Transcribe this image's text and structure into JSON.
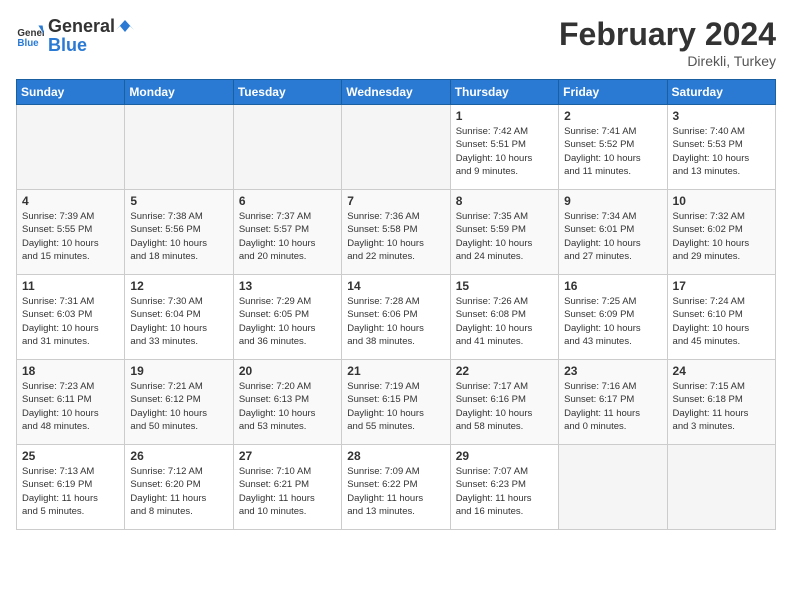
{
  "header": {
    "logo_general": "General",
    "logo_blue": "Blue",
    "title": "February 2024",
    "subtitle": "Direkli, Turkey"
  },
  "days_of_week": [
    "Sunday",
    "Monday",
    "Tuesday",
    "Wednesday",
    "Thursday",
    "Friday",
    "Saturday"
  ],
  "weeks": [
    [
      {
        "day": "",
        "info": ""
      },
      {
        "day": "",
        "info": ""
      },
      {
        "day": "",
        "info": ""
      },
      {
        "day": "",
        "info": ""
      },
      {
        "day": "1",
        "info": "Sunrise: 7:42 AM\nSunset: 5:51 PM\nDaylight: 10 hours\nand 9 minutes."
      },
      {
        "day": "2",
        "info": "Sunrise: 7:41 AM\nSunset: 5:52 PM\nDaylight: 10 hours\nand 11 minutes."
      },
      {
        "day": "3",
        "info": "Sunrise: 7:40 AM\nSunset: 5:53 PM\nDaylight: 10 hours\nand 13 minutes."
      }
    ],
    [
      {
        "day": "4",
        "info": "Sunrise: 7:39 AM\nSunset: 5:55 PM\nDaylight: 10 hours\nand 15 minutes."
      },
      {
        "day": "5",
        "info": "Sunrise: 7:38 AM\nSunset: 5:56 PM\nDaylight: 10 hours\nand 18 minutes."
      },
      {
        "day": "6",
        "info": "Sunrise: 7:37 AM\nSunset: 5:57 PM\nDaylight: 10 hours\nand 20 minutes."
      },
      {
        "day": "7",
        "info": "Sunrise: 7:36 AM\nSunset: 5:58 PM\nDaylight: 10 hours\nand 22 minutes."
      },
      {
        "day": "8",
        "info": "Sunrise: 7:35 AM\nSunset: 5:59 PM\nDaylight: 10 hours\nand 24 minutes."
      },
      {
        "day": "9",
        "info": "Sunrise: 7:34 AM\nSunset: 6:01 PM\nDaylight: 10 hours\nand 27 minutes."
      },
      {
        "day": "10",
        "info": "Sunrise: 7:32 AM\nSunset: 6:02 PM\nDaylight: 10 hours\nand 29 minutes."
      }
    ],
    [
      {
        "day": "11",
        "info": "Sunrise: 7:31 AM\nSunset: 6:03 PM\nDaylight: 10 hours\nand 31 minutes."
      },
      {
        "day": "12",
        "info": "Sunrise: 7:30 AM\nSunset: 6:04 PM\nDaylight: 10 hours\nand 33 minutes."
      },
      {
        "day": "13",
        "info": "Sunrise: 7:29 AM\nSunset: 6:05 PM\nDaylight: 10 hours\nand 36 minutes."
      },
      {
        "day": "14",
        "info": "Sunrise: 7:28 AM\nSunset: 6:06 PM\nDaylight: 10 hours\nand 38 minutes."
      },
      {
        "day": "15",
        "info": "Sunrise: 7:26 AM\nSunset: 6:08 PM\nDaylight: 10 hours\nand 41 minutes."
      },
      {
        "day": "16",
        "info": "Sunrise: 7:25 AM\nSunset: 6:09 PM\nDaylight: 10 hours\nand 43 minutes."
      },
      {
        "day": "17",
        "info": "Sunrise: 7:24 AM\nSunset: 6:10 PM\nDaylight: 10 hours\nand 45 minutes."
      }
    ],
    [
      {
        "day": "18",
        "info": "Sunrise: 7:23 AM\nSunset: 6:11 PM\nDaylight: 10 hours\nand 48 minutes."
      },
      {
        "day": "19",
        "info": "Sunrise: 7:21 AM\nSunset: 6:12 PM\nDaylight: 10 hours\nand 50 minutes."
      },
      {
        "day": "20",
        "info": "Sunrise: 7:20 AM\nSunset: 6:13 PM\nDaylight: 10 hours\nand 53 minutes."
      },
      {
        "day": "21",
        "info": "Sunrise: 7:19 AM\nSunset: 6:15 PM\nDaylight: 10 hours\nand 55 minutes."
      },
      {
        "day": "22",
        "info": "Sunrise: 7:17 AM\nSunset: 6:16 PM\nDaylight: 10 hours\nand 58 minutes."
      },
      {
        "day": "23",
        "info": "Sunrise: 7:16 AM\nSunset: 6:17 PM\nDaylight: 11 hours\nand 0 minutes."
      },
      {
        "day": "24",
        "info": "Sunrise: 7:15 AM\nSunset: 6:18 PM\nDaylight: 11 hours\nand 3 minutes."
      }
    ],
    [
      {
        "day": "25",
        "info": "Sunrise: 7:13 AM\nSunset: 6:19 PM\nDaylight: 11 hours\nand 5 minutes."
      },
      {
        "day": "26",
        "info": "Sunrise: 7:12 AM\nSunset: 6:20 PM\nDaylight: 11 hours\nand 8 minutes."
      },
      {
        "day": "27",
        "info": "Sunrise: 7:10 AM\nSunset: 6:21 PM\nDaylight: 11 hours\nand 10 minutes."
      },
      {
        "day": "28",
        "info": "Sunrise: 7:09 AM\nSunset: 6:22 PM\nDaylight: 11 hours\nand 13 minutes."
      },
      {
        "day": "29",
        "info": "Sunrise: 7:07 AM\nSunset: 6:23 PM\nDaylight: 11 hours\nand 16 minutes."
      },
      {
        "day": "",
        "info": ""
      },
      {
        "day": "",
        "info": ""
      }
    ]
  ]
}
